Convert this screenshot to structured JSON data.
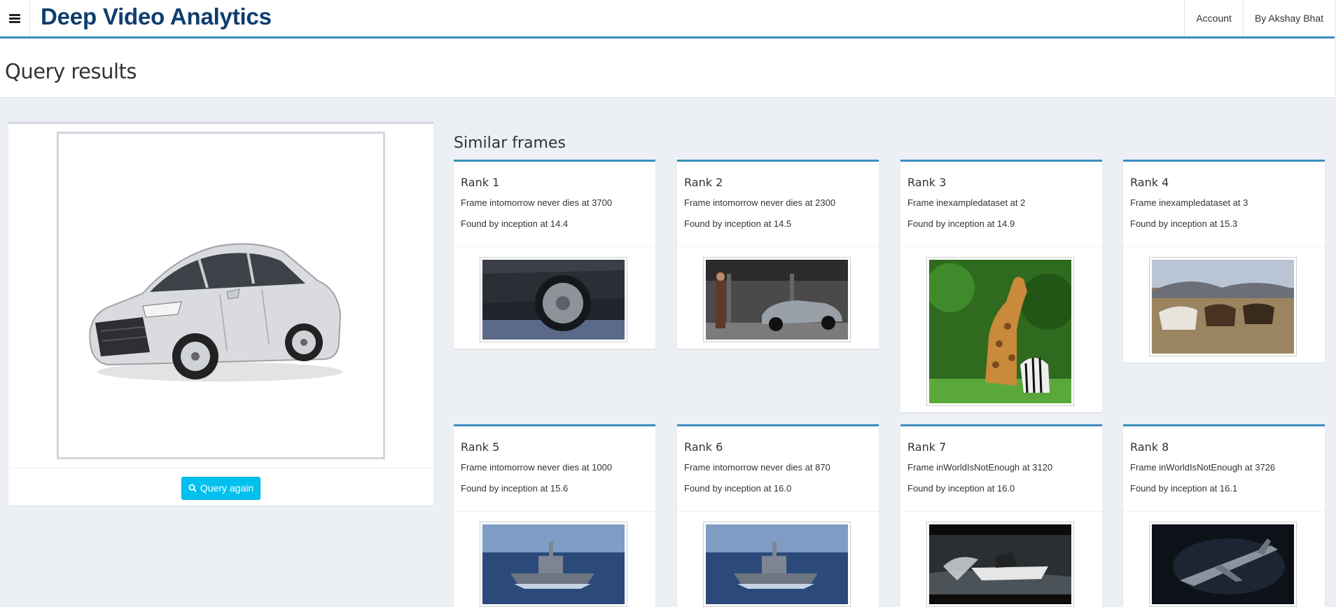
{
  "app": {
    "brand": "Deep Video Analytics",
    "nav": [
      "Account",
      "By Akshay Bhat"
    ]
  },
  "page": {
    "title": "Query results"
  },
  "query": {
    "button_label": "Query again",
    "image_icon": "car-image"
  },
  "results": {
    "title": "Similar frames",
    "items": [
      {
        "rank": "Rank 1",
        "frame": "Frame intomorrow never dies at 3700",
        "found": "Found by inception at 14.4",
        "thumb": "car-wheel-frame"
      },
      {
        "rank": "Rank 2",
        "frame": "Frame intomorrow never dies at 2300",
        "found": "Found by inception at 14.5",
        "thumb": "garage-car-frame"
      },
      {
        "rank": "Rank 3",
        "frame": "Frame inexampledataset at 2",
        "found": "Found by inception at 14.9",
        "thumb": "giraffe-zebra-frame"
      },
      {
        "rank": "Rank 4",
        "frame": "Frame inexampledataset at 3",
        "found": "Found by inception at 15.3",
        "thumb": "horses-frame"
      },
      {
        "rank": "Rank 5",
        "frame": "Frame intomorrow never dies at 1000",
        "found": "Found by inception at 15.6",
        "thumb": "warship-frame"
      },
      {
        "rank": "Rank 6",
        "frame": "Frame intomorrow never dies at 870",
        "found": "Found by inception at 16.0",
        "thumb": "warship-frame"
      },
      {
        "rank": "Rank 7",
        "frame": "Frame inWorldIsNotEnough at 3120",
        "found": "Found by inception at 16.0",
        "thumb": "speedboat-frame"
      },
      {
        "rank": "Rank 8",
        "frame": "Frame inWorldIsNotEnough at 3726",
        "found": "Found by inception at 16.1",
        "thumb": "jet-frame"
      }
    ]
  }
}
